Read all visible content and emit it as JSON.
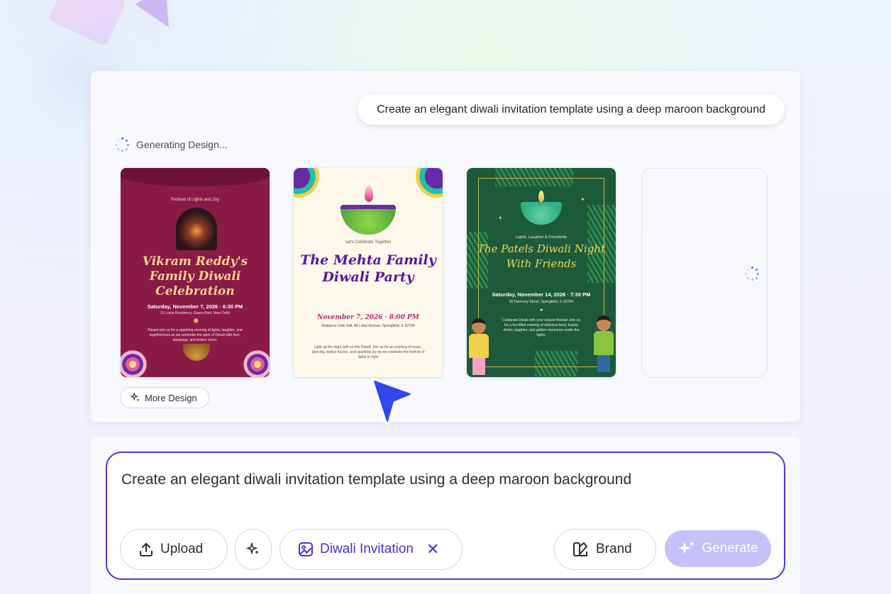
{
  "prompt_bubble": "Create an elegant diwali invitation template using a deep maroon background",
  "status": "Generating Design...",
  "cards": [
    {
      "subtitle": "Festival of Lights and Joy",
      "title": "Vikram Reddy's Family Diwali Celebration",
      "date": "Saturday, November 7, 2026 · 6:30 PM",
      "address": "15 Lotus Residency, Green Park, New Delhi",
      "body": "Please join us for a sparkling evening of lights, laughter, and togetherness as we celebrate the spirit of Diwali with love, blessings, and festive cheer."
    },
    {
      "subtitle": "Let's Celebrate Together",
      "title": "The Mehta Family Diwali Party",
      "date": "November 7, 2026 · 8:00 PM",
      "address": "Radiance Club Hall, 88 Lotus Avenue, Springfield, IL 62704",
      "body": "Light up the night with us this Diwali! Join us for an evening of music, dancing, festive flavors, and sparkling joy as we celebrate the festival of lights in style"
    },
    {
      "subtitle": "Lights, Laughter & Friendship",
      "title": "The Patels Diwali Night With Friends",
      "date": "Saturday, November 14, 2026 · 7:30 PM",
      "address": "56 Harmony Street, Springfield, IL 62704",
      "body": "Celebrate Diwali with your closest friends! Join us for a fun-filled evening of delicious food, festive drinks, laughter, and golden memories under the lights."
    }
  ],
  "more_design_label": "More Design",
  "composer": {
    "text": "Create an elegant diwali invitation template using a deep maroon background",
    "upload_label": "Upload",
    "tag_label": "Diwali Invitation",
    "brand_label": "Brand",
    "generate_label": "Generate"
  },
  "colors": {
    "accent": "#4532d6",
    "generate_disabled": "#c6c0fb",
    "maroon": "#8a1b46",
    "green": "#1d5a3c"
  },
  "icons": {
    "upload": "upload-icon",
    "magic": "sparkle-icon",
    "tag": "image-edit-icon",
    "remove": "close-icon",
    "brand": "palette-icon",
    "generate": "sparkle-icon"
  }
}
